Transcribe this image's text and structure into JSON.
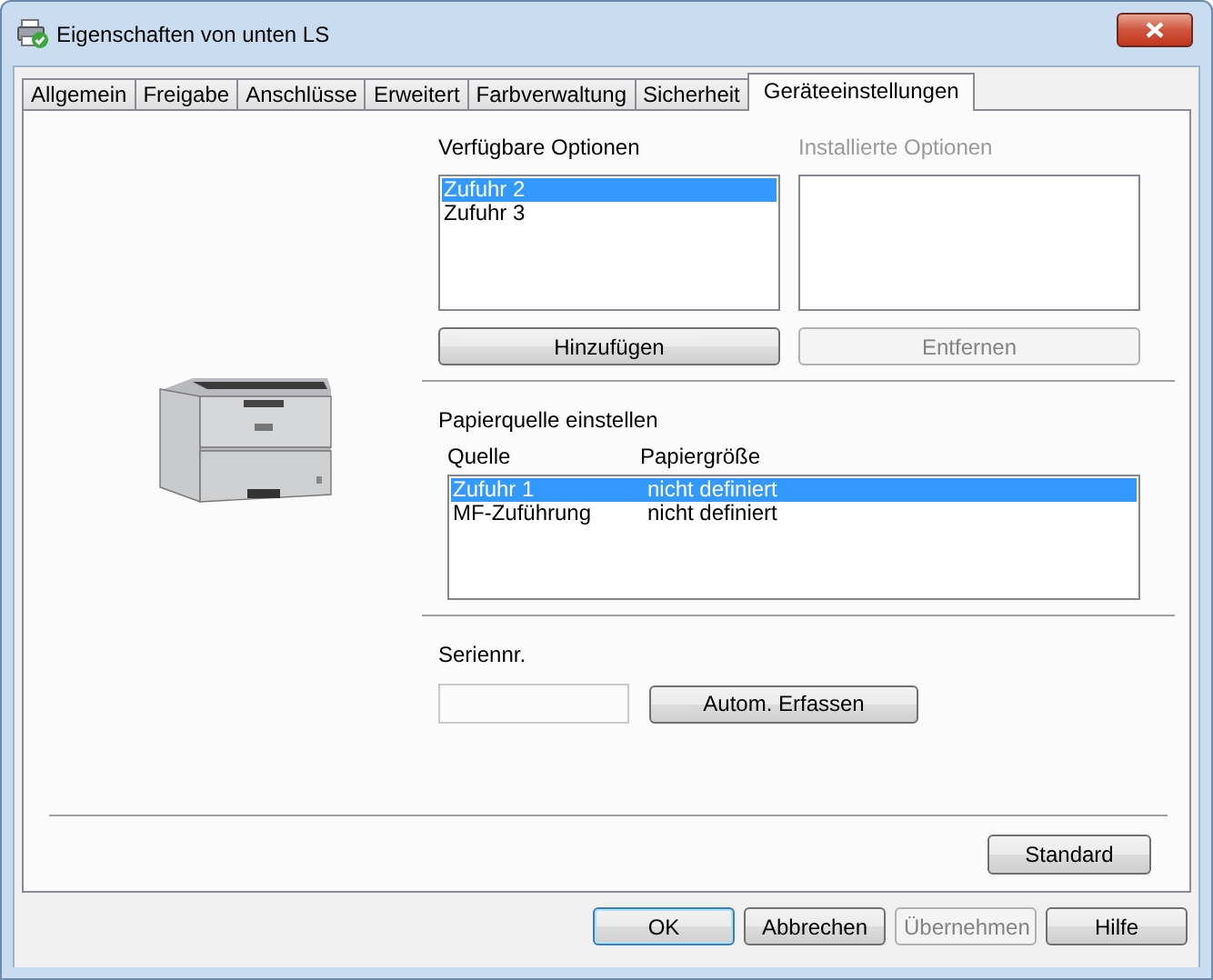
{
  "window": {
    "title": "Eigenschaften von unten LS"
  },
  "tabs": [
    {
      "label": "Allgemein",
      "selected": false
    },
    {
      "label": "Freigabe",
      "selected": false
    },
    {
      "label": "Anschlüsse",
      "selected": false
    },
    {
      "label": "Erweitert",
      "selected": false
    },
    {
      "label": "Farbverwaltung",
      "selected": false
    },
    {
      "label": "Sicherheit",
      "selected": false
    },
    {
      "label": "Geräteeinstellungen",
      "selected": true
    }
  ],
  "available_options": {
    "label": "Verfügbare Optionen",
    "disabled": false,
    "items": [
      {
        "label": "Zufuhr 2",
        "selected": true
      },
      {
        "label": "Zufuhr 3",
        "selected": false
      }
    ]
  },
  "installed_options": {
    "label": "Installierte Optionen",
    "disabled": true
  },
  "add_button": {
    "label": "Hinzufügen",
    "disabled": false
  },
  "remove_button": {
    "label": "Entfernen",
    "disabled": true
  },
  "paper_source": {
    "title": "Papierquelle einstellen",
    "columns": [
      "Quelle",
      "Papiergröße"
    ],
    "rows": [
      {
        "source": "Zufuhr 1",
        "paper_size": "nicht definiert",
        "selected": true
      },
      {
        "source": "MF-Zuführung",
        "paper_size": "nicht definiert",
        "selected": false
      }
    ]
  },
  "serial": {
    "label": "Seriennr.",
    "button": "Autom. Erfassen"
  },
  "standard_button": {
    "label": "Standard",
    "disabled": false
  },
  "dialog_buttons": [
    {
      "label": "OK",
      "default": true,
      "disabled": false
    },
    {
      "label": "Abbrechen",
      "default": false,
      "disabled": false
    },
    {
      "label": "Übernehmen",
      "default": false,
      "disabled": true
    },
    {
      "label": "Hilfe",
      "default": false,
      "disabled": false
    }
  ]
}
